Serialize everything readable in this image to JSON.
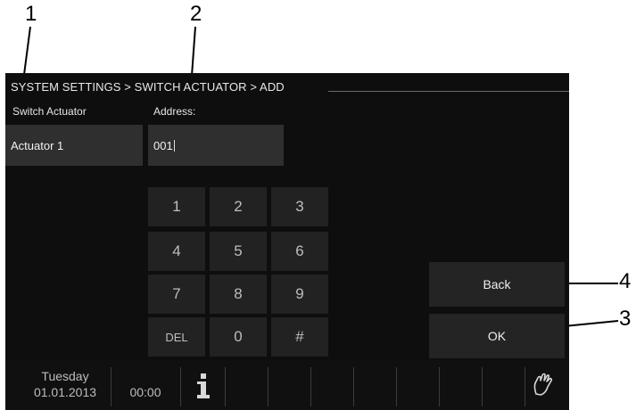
{
  "callouts": [
    "1",
    "2",
    "4",
    "3"
  ],
  "breadcrumb": "SYSTEM SETTINGS > SWITCH ACTUATOR > ADD",
  "labels": {
    "switch_actuator": "Switch Actuator",
    "address": "Address:"
  },
  "fields": {
    "actuator_name": "Actuator 1",
    "address_value": "001"
  },
  "keypad": [
    "1",
    "2",
    "3",
    "4",
    "5",
    "6",
    "7",
    "8",
    "9",
    "DEL",
    "0",
    "#"
  ],
  "buttons": {
    "back": "Back",
    "ok": "OK"
  },
  "status": {
    "day": "Tuesday",
    "date": "01.01.2013",
    "time": "00:00",
    "info_icon": "info-icon",
    "hand_icon": "hand-icon"
  }
}
